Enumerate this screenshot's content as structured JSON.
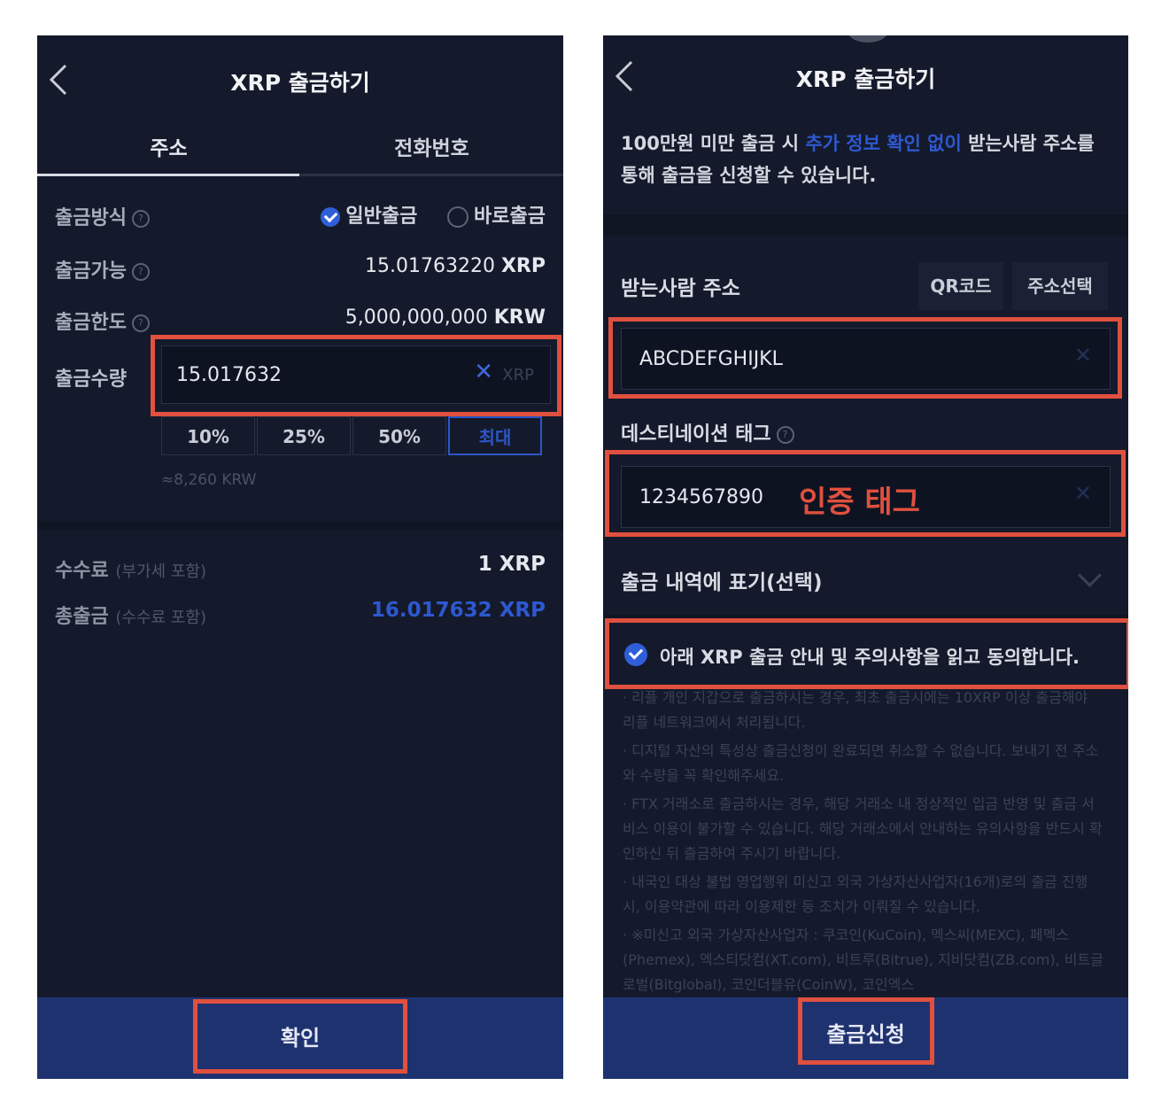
{
  "left": {
    "title": "XRP 출금하기",
    "tabs": [
      "주소",
      "전화번호"
    ],
    "method_label": "출금방식",
    "method_options": [
      "일반출금",
      "바로출금"
    ],
    "available_label": "출금가능",
    "available_value": "15.01763220",
    "available_unit": "XRP",
    "limit_label": "출금한도",
    "limit_value": "5,000,000,000",
    "limit_unit": "KRW",
    "amount_label": "출금수량",
    "amount_value": "15.017632",
    "amount_unit": "XRP",
    "percent_buttons": [
      "10%",
      "25%",
      "50%",
      "최대"
    ],
    "krw_approx": "≈8,260 KRW",
    "fee_label": "수수료",
    "fee_note": "(부가세 포함)",
    "fee_value": "1 XRP",
    "total_label": "총출금",
    "total_note": "(수수료 포함)",
    "total_value": "16.017632 XRP",
    "confirm_label": "확인"
  },
  "right": {
    "title": "XRP 출금하기",
    "notice_pre": "100만원 미만 출금 시 ",
    "notice_hl": "추가 정보 확인 없이",
    "notice_post": " 받는사람 주소를 통해 출금을 신청할 수 있습니다.",
    "recipient_label": "받는사람 주소",
    "qr_label": "QR코드",
    "address_select_label": "주소선택",
    "address_value": "ABCDEFGHIJKL",
    "tag_label": "데스티네이션 태그",
    "tag_value": "1234567890",
    "tag_annotation": "인증 태그",
    "memo_label": "출금 내역에 표기(선택)",
    "agree_text": "아래 XRP 출금 안내 및 주의사항을 읽고 동의합니다.",
    "guide_items": [
      "· 리플 개인 지갑으로 출금하시는 경우, 최초 출금시에는 10XRP 이상 출금해야 리플 네트워크에서 처리됩니다.",
      "· 디지털 자산의 특성상 출금신청이 완료되면 취소할 수 없습니다. 보내기 전 주소와 수량을 꼭 확인해주세요.",
      "· FTX 거래소로 출금하시는 경우, 해당 거래소 내 정상적인 입금 반영 및 출금 서비스 이용이 불가할 수 있습니다. 해당 거래소에서 안내하는 유의사항을 반드시 확인하신 뒤 출금하여 주시기 바랍니다.",
      "· 내국인 대상 불법 영업행위 미신고 외국 가상자산사업자(16개)로의 출금 진행 시, 이용약관에 따라 이용제한 등 조치가 이뤄질 수 있습니다.",
      "· ※미신고 외국 가상자산사업자 : 쿠코인(KuCoin), 멕스씨(MEXC), 페멕스(Phemex), 엑스티닷컴(XT.com), 비트루(Bitrue), 지비닷컴(ZB.com), 비트글로벌(Bitglobal), 코인더블유(CoinW), 코인엑스"
    ],
    "submit_label": "출금신청"
  },
  "colors": {
    "background": "#141a2b",
    "accent": "#2e58d0",
    "highlight": "#e0503e",
    "bottom_bar": "#1f3270"
  }
}
